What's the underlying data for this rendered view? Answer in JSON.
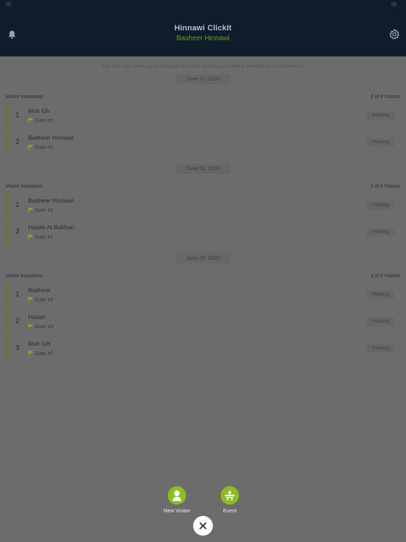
{
  "header": {
    "title": "Hinnawi ClickIt",
    "subtitle": "Basheer Hinnawi",
    "left_icon": "bell-icon",
    "right_icon": "gear-icon"
  },
  "notice": "You can only invite up to 5 people per day, unless you have a meeting or a conference.",
  "days": [
    {
      "date": "June 27, 2020",
      "group_label": "Visitor Invitations",
      "count": "2 of 5 Visitors",
      "visitors": [
        {
          "num": "1",
          "name": "Moh Gh",
          "gate": "Gate #1",
          "status": "Pending"
        },
        {
          "num": "2",
          "name": "Basheer Hinnawi",
          "gate": "Gate #2",
          "status": "Pending"
        }
      ]
    },
    {
      "date": "June 28, 2020",
      "group_label": "Visitor Invitations",
      "count": "2 of 5 Visitors",
      "visitors": [
        {
          "num": "1",
          "name": "Basheer Hinnawi",
          "gate": "Gate #2",
          "status": "Pending"
        },
        {
          "num": "2",
          "name": "Hasan Al Bukhari",
          "gate": "Gate #1",
          "status": "Pending"
        }
      ]
    },
    {
      "date": "June 29, 2020",
      "group_label": "Visitor Invitations",
      "count": "3 of 5 Visitors",
      "visitors": [
        {
          "num": "1",
          "name": "Basheer",
          "gate": "Gate #3",
          "status": "Pending"
        },
        {
          "num": "2",
          "name": "Hasan",
          "gate": "Gate #3",
          "status": "Pending"
        },
        {
          "num": "3",
          "name": "Moh GH",
          "gate": "Gate #2",
          "status": "Pending"
        }
      ]
    }
  ],
  "fab": {
    "new_visitor_label": "New Visitor",
    "event_label": "Event",
    "accent": "#8bbf1f"
  },
  "colors": {
    "header_bg": "#0f1c2a",
    "title": "#b9c0c8",
    "subtitle": "#6f9a2a",
    "overlay_bg": "#6b6c6b",
    "gate_flag": "#7fae22"
  }
}
